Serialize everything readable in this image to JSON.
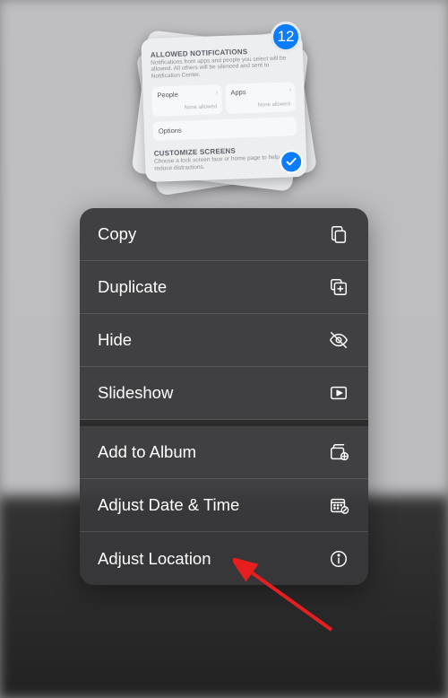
{
  "selection": {
    "count": "12",
    "preview_card": {
      "section1_title": "ALLOWED NOTIFICATIONS",
      "section1_sub": "Notifications from apps and people you select will be allowed. All others will be silenced and sent to Notification Center.",
      "people_label": "People",
      "apps_label": "Apps",
      "none_label": "None allowed",
      "options_label": "Options",
      "section2_title": "CUSTOMIZE SCREENS",
      "section2_sub": "Choose a lock screen face or home page to help reduce distractions."
    }
  },
  "menu": {
    "copy": "Copy",
    "duplicate": "Duplicate",
    "hide": "Hide",
    "slideshow": "Slideshow",
    "add_to_album": "Add to Album",
    "adjust_datetime": "Adjust Date & Time",
    "adjust_location": "Adjust Location"
  }
}
